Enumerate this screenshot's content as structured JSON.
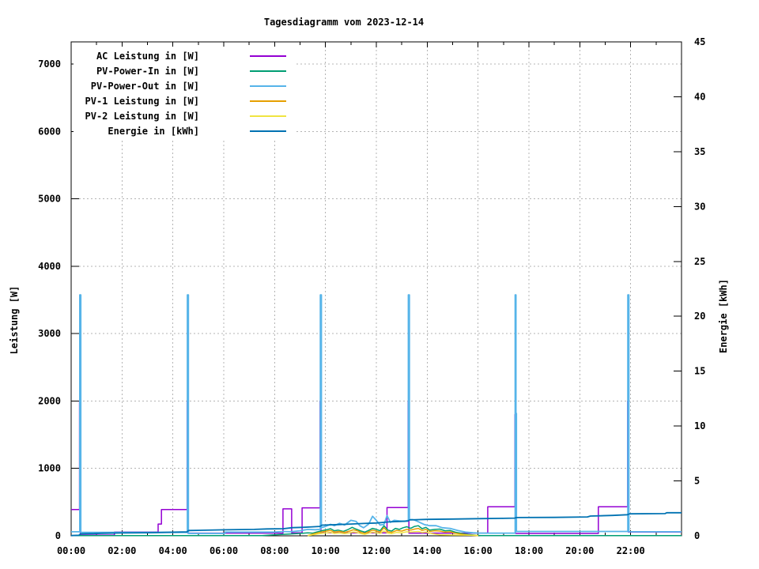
{
  "title": "Tagesdiagramm vom 2023-12-14",
  "axes": {
    "left_label": "Leistung [W]",
    "right_label": "Energie [kWh]",
    "left_ticks": [
      0,
      1000,
      2000,
      3000,
      4000,
      5000,
      6000,
      7000
    ],
    "right_ticks": [
      0,
      5,
      10,
      15,
      20,
      25,
      30,
      35,
      40,
      45
    ],
    "x_tick_labels": [
      "00:00",
      "02:00",
      "04:00",
      "06:00",
      "08:00",
      "10:00",
      "12:00",
      "14:00",
      "16:00",
      "18:00",
      "20:00",
      "22:00"
    ],
    "x_major_hours": [
      0,
      2,
      4,
      6,
      8,
      10,
      12,
      14,
      16,
      18,
      20,
      22,
      24
    ],
    "x_minor_hours": [
      1,
      3,
      5,
      7,
      9,
      11,
      13,
      15,
      17,
      19,
      21,
      23
    ]
  },
  "legend": [
    {
      "label": "AC Leistung in [W]",
      "color": "#9400D3"
    },
    {
      "label": "PV-Power-In in [W]",
      "color": "#009E73"
    },
    {
      "label": "PV-Power-Out in [W]",
      "color": "#56B4E9"
    },
    {
      "label": "PV-1 Leistung in [W]",
      "color": "#E69F00"
    },
    {
      "label": "PV-2 Leistung in [W]",
      "color": "#F0E442"
    },
    {
      "label": "Energie in [kWh]",
      "color": "#0072B2"
    }
  ],
  "colors": {
    "ac": "#9400D3",
    "pv_in": "#009E73",
    "pv_out": "#56B4E9",
    "pv1": "#E69F00",
    "pv2": "#F0E442",
    "energie": "#0072B2",
    "grid": "#b4b4b4",
    "axis": "#000000",
    "background": "#ffffff"
  },
  "chart_data": {
    "type": "line",
    "title": "Tagesdiagramm vom 2023-12-14",
    "x_unit": "hours",
    "x_range": [
      0,
      24
    ],
    "left_axis": {
      "label": "Leistung [W]",
      "lim": [
        0,
        7330
      ],
      "tick_step": 1000
    },
    "right_axis": {
      "label": "Energie [kWh]",
      "lim": [
        0,
        45
      ],
      "tick_step": 5
    },
    "grid": true,
    "legend_position": "top-left-inside",
    "series": [
      {
        "name": "AC Leistung in [W]",
        "axis": "left",
        "color": "#9400D3",
        "points": [
          [
            0,
            390
          ],
          [
            0.33,
            390
          ],
          [
            0.33,
            2000
          ],
          [
            0.36,
            2000
          ],
          [
            0.36,
            10
          ],
          [
            1.7,
            10
          ],
          [
            1.7,
            55
          ],
          [
            3.42,
            55
          ],
          [
            3.42,
            175
          ],
          [
            3.55,
            175
          ],
          [
            3.55,
            390
          ],
          [
            4.56,
            390
          ],
          [
            4.56,
            2000
          ],
          [
            4.59,
            2000
          ],
          [
            4.59,
            40
          ],
          [
            8.33,
            40
          ],
          [
            8.33,
            400
          ],
          [
            8.67,
            400
          ],
          [
            8.67,
            45
          ],
          [
            9.08,
            45
          ],
          [
            9.08,
            415
          ],
          [
            9.79,
            415
          ],
          [
            9.79,
            2000
          ],
          [
            9.82,
            2000
          ],
          [
            9.82,
            45
          ],
          [
            12.42,
            45
          ],
          [
            12.42,
            420
          ],
          [
            13.25,
            420
          ],
          [
            13.25,
            2000
          ],
          [
            13.28,
            2000
          ],
          [
            13.28,
            40
          ],
          [
            16.38,
            40
          ],
          [
            16.38,
            430
          ],
          [
            17.45,
            430
          ],
          [
            17.45,
            1800
          ],
          [
            17.47,
            1800
          ],
          [
            17.47,
            35
          ],
          [
            20.73,
            35
          ],
          [
            20.73,
            430
          ],
          [
            21.88,
            430
          ],
          [
            21.88,
            2000
          ],
          [
            21.91,
            2000
          ],
          [
            21.91,
            55
          ],
          [
            24,
            55
          ]
        ]
      },
      {
        "name": "PV-Power-In in [W]",
        "axis": "left",
        "color": "#009E73",
        "points": [
          [
            0,
            4
          ],
          [
            7.5,
            4
          ],
          [
            8.0,
            15
          ],
          [
            8.5,
            25
          ],
          [
            9.0,
            35
          ],
          [
            9.3,
            45
          ],
          [
            9.5,
            40
          ],
          [
            9.7,
            60
          ],
          [
            9.9,
            80
          ],
          [
            10.05,
            90
          ],
          [
            10.2,
            105
          ],
          [
            10.35,
            75
          ],
          [
            10.5,
            85
          ],
          [
            10.7,
            65
          ],
          [
            10.9,
            95
          ],
          [
            11.05,
            125
          ],
          [
            11.2,
            100
          ],
          [
            11.4,
            70
          ],
          [
            11.55,
            55
          ],
          [
            11.7,
            80
          ],
          [
            11.85,
            110
          ],
          [
            12.0,
            95
          ],
          [
            12.15,
            75
          ],
          [
            12.3,
            150
          ],
          [
            12.45,
            85
          ],
          [
            12.6,
            70
          ],
          [
            12.75,
            110
          ],
          [
            12.9,
            95
          ],
          [
            13.05,
            120
          ],
          [
            13.2,
            135
          ],
          [
            13.35,
            110
          ],
          [
            13.5,
            140
          ],
          [
            13.65,
            150
          ],
          [
            13.8,
            105
          ],
          [
            13.95,
            125
          ],
          [
            14.1,
            85
          ],
          [
            14.3,
            95
          ],
          [
            14.5,
            100
          ],
          [
            14.7,
            75
          ],
          [
            14.9,
            80
          ],
          [
            15.1,
            55
          ],
          [
            15.3,
            40
          ],
          [
            15.6,
            20
          ],
          [
            15.9,
            10
          ],
          [
            16.1,
            4
          ],
          [
            24,
            4
          ]
        ]
      },
      {
        "name": "PV-Power-Out in [W]",
        "axis": "left",
        "color": "#56B4E9",
        "points": [
          [
            0,
            60
          ],
          [
            0.34,
            60
          ],
          [
            0.34,
            3576
          ],
          [
            0.38,
            3576
          ],
          [
            0.38,
            50
          ],
          [
            4.57,
            50
          ],
          [
            4.57,
            3576
          ],
          [
            4.61,
            3576
          ],
          [
            4.61,
            35
          ],
          [
            6.05,
            35
          ],
          [
            6.05,
            55
          ],
          [
            8.0,
            55
          ],
          [
            8.3,
            65
          ],
          [
            8.6,
            60
          ],
          [
            9.0,
            75
          ],
          [
            9.3,
            95
          ],
          [
            9.6,
            90
          ],
          [
            9.8,
            95
          ],
          [
            9.8,
            3576
          ],
          [
            9.84,
            3576
          ],
          [
            9.84,
            120
          ],
          [
            10.0,
            140
          ],
          [
            10.2,
            170
          ],
          [
            10.35,
            150
          ],
          [
            10.55,
            185
          ],
          [
            10.75,
            160
          ],
          [
            11.0,
            230
          ],
          [
            11.2,
            215
          ],
          [
            11.35,
            150
          ],
          [
            11.5,
            120
          ],
          [
            11.7,
            175
          ],
          [
            11.85,
            290
          ],
          [
            12.0,
            230
          ],
          [
            12.15,
            160
          ],
          [
            12.3,
            170
          ],
          [
            12.42,
            300
          ],
          [
            12.55,
            200
          ],
          [
            12.7,
            230
          ],
          [
            12.9,
            220
          ],
          [
            13.1,
            215
          ],
          [
            13.26,
            230
          ],
          [
            13.26,
            3576
          ],
          [
            13.3,
            3576
          ],
          [
            13.3,
            250
          ],
          [
            13.5,
            235
          ],
          [
            13.7,
            200
          ],
          [
            13.9,
            165
          ],
          [
            14.1,
            150
          ],
          [
            14.35,
            150
          ],
          [
            14.6,
            120
          ],
          [
            14.9,
            110
          ],
          [
            15.2,
            80
          ],
          [
            15.5,
            55
          ],
          [
            15.8,
            45
          ],
          [
            16.1,
            40
          ],
          [
            17.46,
            40
          ],
          [
            17.46,
            3576
          ],
          [
            17.49,
            3576
          ],
          [
            17.49,
            1817
          ],
          [
            17.51,
            1817
          ],
          [
            17.51,
            65
          ],
          [
            21.89,
            65
          ],
          [
            21.89,
            3576
          ],
          [
            21.93,
            3576
          ],
          [
            21.93,
            60
          ],
          [
            24,
            60
          ]
        ]
      },
      {
        "name": "PV-1 Leistung in [W]",
        "axis": "left",
        "color": "#E69F00",
        "points": [
          [
            9.3,
            5
          ],
          [
            9.5,
            25
          ],
          [
            9.7,
            45
          ],
          [
            9.9,
            60
          ],
          [
            10.05,
            70
          ],
          [
            10.2,
            80
          ],
          [
            10.35,
            55
          ],
          [
            10.55,
            65
          ],
          [
            10.75,
            50
          ],
          [
            10.95,
            70
          ],
          [
            11.1,
            90
          ],
          [
            11.25,
            75
          ],
          [
            11.4,
            50
          ],
          [
            11.55,
            35
          ],
          [
            11.7,
            60
          ],
          [
            11.85,
            85
          ],
          [
            12.0,
            70
          ],
          [
            12.15,
            55
          ],
          [
            12.3,
            120
          ],
          [
            12.45,
            60
          ],
          [
            12.6,
            50
          ],
          [
            12.8,
            80
          ],
          [
            13.0,
            70
          ],
          [
            13.2,
            95
          ],
          [
            13.35,
            85
          ],
          [
            13.5,
            100
          ],
          [
            13.65,
            110
          ],
          [
            13.8,
            80
          ],
          [
            13.95,
            95
          ],
          [
            14.1,
            65
          ],
          [
            14.3,
            75
          ],
          [
            14.5,
            70
          ],
          [
            14.7,
            55
          ],
          [
            14.9,
            60
          ],
          [
            15.1,
            40
          ],
          [
            15.3,
            28
          ],
          [
            15.6,
            12
          ],
          [
            15.9,
            5
          ],
          [
            16.0,
            2
          ]
        ]
      },
      {
        "name": "PV-2 Leistung in [W]",
        "axis": "left",
        "color": "#F0E442",
        "points": [
          [
            9.3,
            3
          ],
          [
            9.5,
            15
          ],
          [
            9.7,
            28
          ],
          [
            9.9,
            38
          ],
          [
            10.05,
            45
          ],
          [
            10.2,
            52
          ],
          [
            10.35,
            35
          ],
          [
            10.55,
            42
          ],
          [
            10.75,
            32
          ],
          [
            10.95,
            45
          ],
          [
            11.1,
            58
          ],
          [
            11.25,
            48
          ],
          [
            11.4,
            32
          ],
          [
            11.55,
            22
          ],
          [
            11.7,
            38
          ],
          [
            11.85,
            55
          ],
          [
            12.0,
            45
          ],
          [
            12.15,
            35
          ],
          [
            12.3,
            72
          ],
          [
            12.45,
            40
          ],
          [
            12.6,
            32
          ],
          [
            12.8,
            50
          ],
          [
            13.0,
            45
          ],
          [
            13.2,
            60
          ],
          [
            13.35,
            55
          ],
          [
            13.5,
            62
          ],
          [
            13.65,
            65
          ],
          [
            13.8,
            50
          ],
          [
            13.95,
            58
          ],
          [
            14.1,
            40
          ],
          [
            14.3,
            25
          ],
          [
            14.5,
            15
          ],
          [
            15.0,
            12
          ],
          [
            15.5,
            10
          ],
          [
            15.9,
            8
          ],
          [
            16.0,
            3
          ]
        ]
      },
      {
        "name": "Energie in [kWh]",
        "axis": "right",
        "color": "#0072B2",
        "points": [
          [
            0,
            0.02
          ],
          [
            0.3,
            0.05
          ],
          [
            0.38,
            0.18
          ],
          [
            0.9,
            0.2
          ],
          [
            1.2,
            0.23
          ],
          [
            2.0,
            0.26
          ],
          [
            3.0,
            0.28
          ],
          [
            3.6,
            0.31
          ],
          [
            4.55,
            0.36
          ],
          [
            4.62,
            0.48
          ],
          [
            6.05,
            0.55
          ],
          [
            7.2,
            0.58
          ],
          [
            7.7,
            0.63
          ],
          [
            8.35,
            0.65
          ],
          [
            8.7,
            0.74
          ],
          [
            9.1,
            0.77
          ],
          [
            9.5,
            0.82
          ],
          [
            9.78,
            0.86
          ],
          [
            9.86,
            0.97
          ],
          [
            10.5,
            1.02
          ],
          [
            11.0,
            1.07
          ],
          [
            11.5,
            1.12
          ],
          [
            12.0,
            1.17
          ],
          [
            12.5,
            1.27
          ],
          [
            13.0,
            1.32
          ],
          [
            13.24,
            1.35
          ],
          [
            13.31,
            1.45
          ],
          [
            14.0,
            1.5
          ],
          [
            15.0,
            1.53
          ],
          [
            16.0,
            1.56
          ],
          [
            17.0,
            1.59
          ],
          [
            17.44,
            1.61
          ],
          [
            17.51,
            1.66
          ],
          [
            19.0,
            1.68
          ],
          [
            20.3,
            1.72
          ],
          [
            20.42,
            1.8
          ],
          [
            21.3,
            1.86
          ],
          [
            21.87,
            1.92
          ],
          [
            21.95,
            2.0
          ],
          [
            23.35,
            2.02
          ],
          [
            23.42,
            2.1
          ],
          [
            24,
            2.1
          ]
        ]
      }
    ]
  }
}
